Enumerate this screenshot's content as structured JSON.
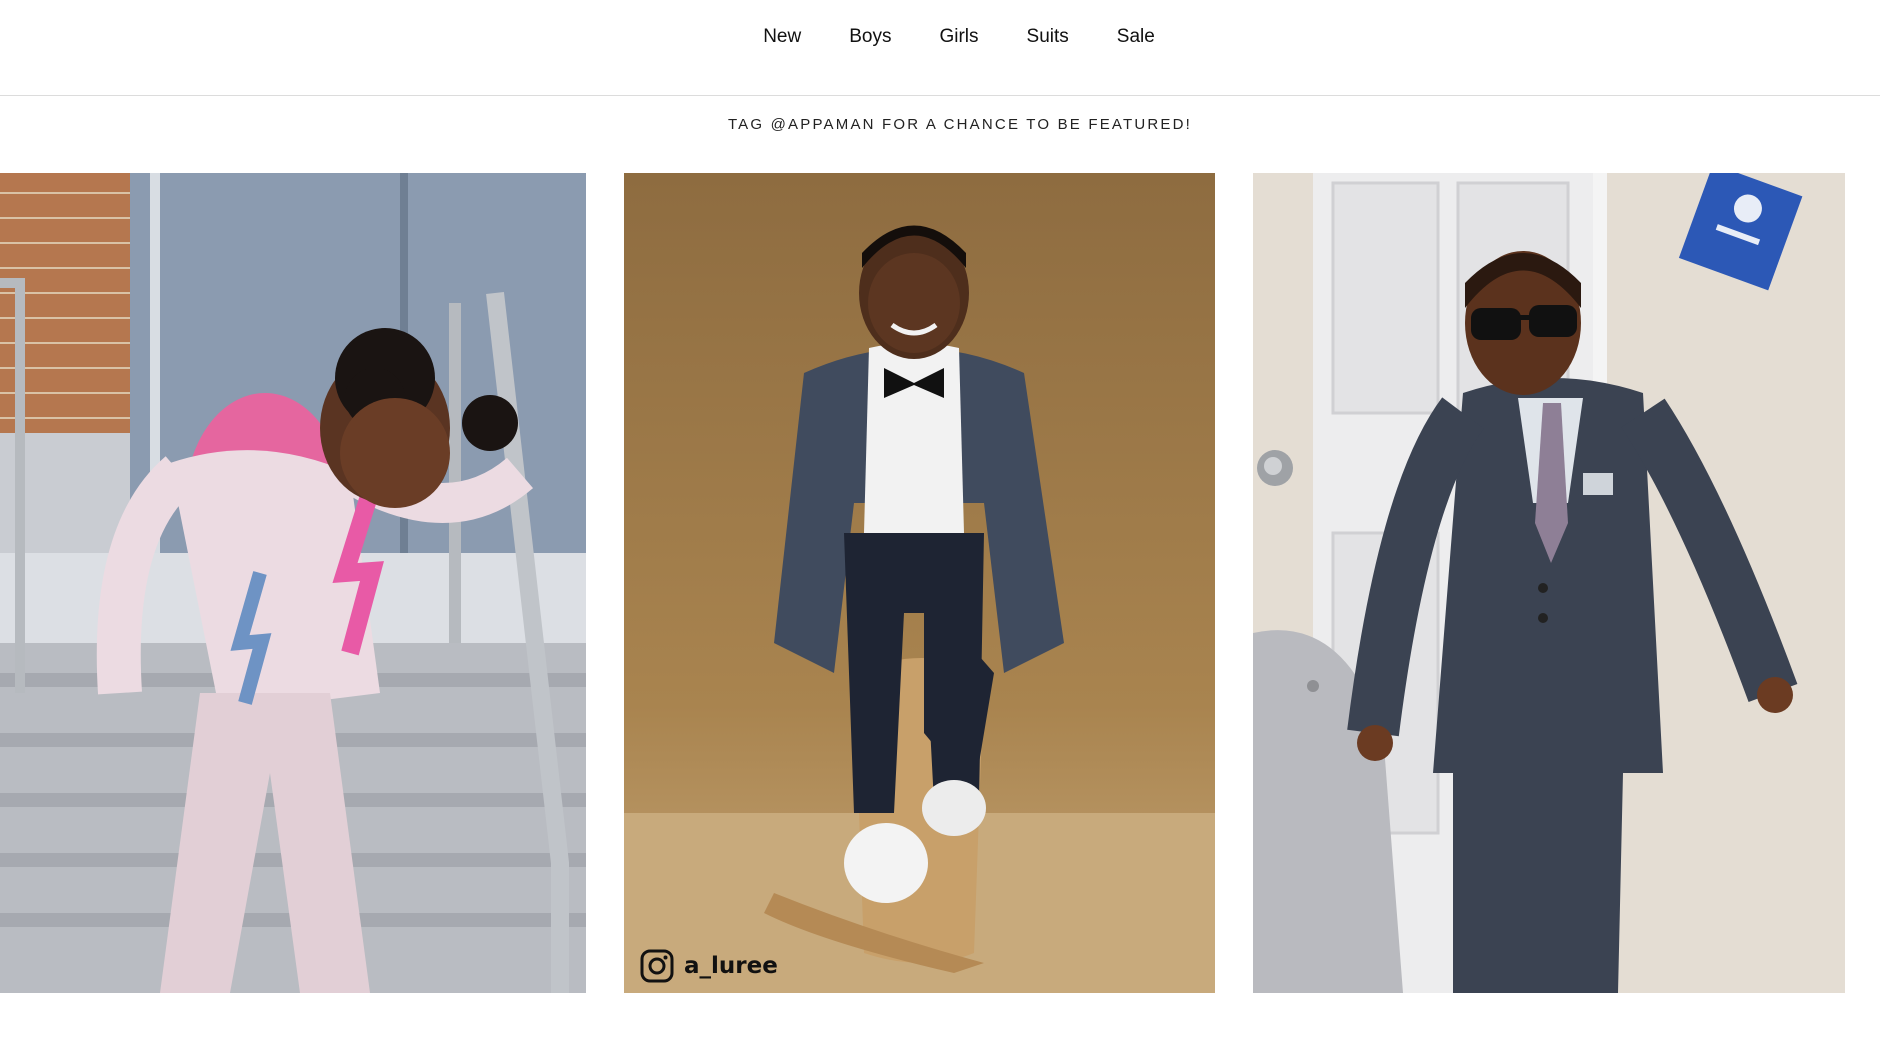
{
  "nav": {
    "items": [
      {
        "label": "New"
      },
      {
        "label": "Boys"
      },
      {
        "label": "Girls"
      },
      {
        "label": "Suits"
      },
      {
        "label": "Sale"
      }
    ]
  },
  "feature": {
    "tagline": "TAG @APPAMAN FOR A CHANCE TO BE FEATURED!"
  },
  "gallery": {
    "tiles": [
      {
        "icon": "photo-girl-on-stairs"
      },
      {
        "icon": "photo-boy-in-tuxedo",
        "credit": {
          "icon": "instagram-icon",
          "handle": "a_luree"
        }
      },
      {
        "icon": "photo-boy-in-suit-sunglasses"
      }
    ]
  },
  "colors": {
    "tan_backdrop": "#a07b48",
    "suit_navy": "#3a4656",
    "sweatshirt_pink": "#e7d6dc"
  }
}
